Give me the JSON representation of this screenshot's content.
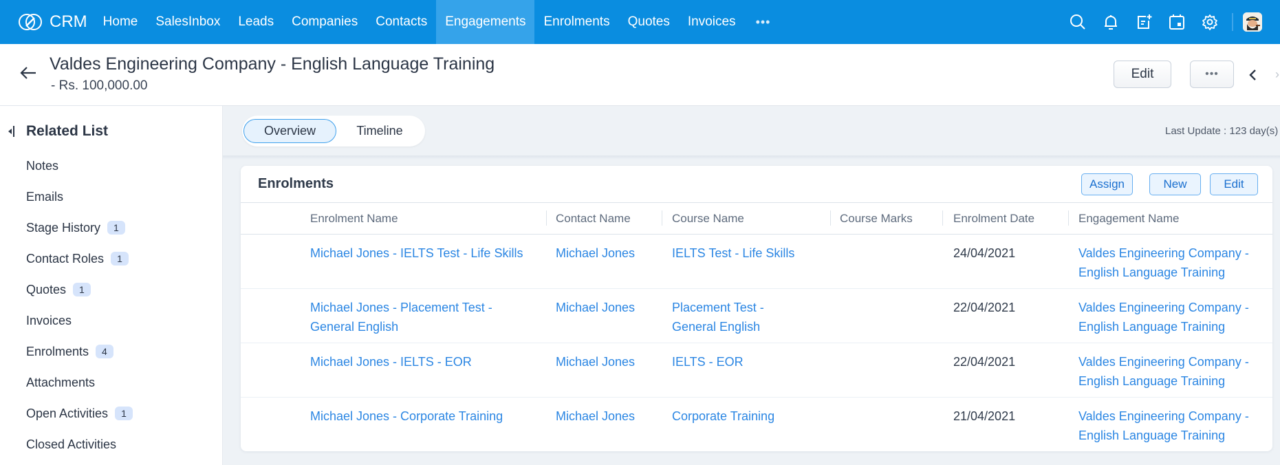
{
  "nav": {
    "brand": "CRM",
    "items": [
      {
        "label": "Home",
        "active": false
      },
      {
        "label": "SalesInbox",
        "active": false
      },
      {
        "label": "Leads",
        "active": false
      },
      {
        "label": "Companies",
        "active": false
      },
      {
        "label": "Contacts",
        "active": false
      },
      {
        "label": "Engagements",
        "active": true
      },
      {
        "label": "Enrolments",
        "active": false
      },
      {
        "label": "Quotes",
        "active": false
      },
      {
        "label": "Invoices",
        "active": false
      }
    ],
    "more": "•••",
    "icons": [
      "search-icon",
      "bell-icon",
      "new-note-icon",
      "calendar-icon",
      "gear-icon"
    ],
    "colors": {
      "bar": "#0a8de0",
      "active": "#35a3ea"
    }
  },
  "record": {
    "title": "Valdes Engineering Company - English Language Training",
    "subtitle": "-  Rs. 100,000.00",
    "edit_label": "Edit",
    "more_label": "•••",
    "next_partial": "›"
  },
  "sidebar": {
    "title": "Related List",
    "items": [
      {
        "label": "Notes",
        "count": null
      },
      {
        "label": "Emails",
        "count": null
      },
      {
        "label": "Stage History",
        "count": "1"
      },
      {
        "label": "Contact Roles",
        "count": "1"
      },
      {
        "label": "Quotes",
        "count": "1"
      },
      {
        "label": "Invoices",
        "count": null
      },
      {
        "label": "Enrolments",
        "count": "4"
      },
      {
        "label": "Attachments",
        "count": null
      },
      {
        "label": "Open Activities",
        "count": "1"
      },
      {
        "label": "Closed Activities",
        "count": null
      }
    ]
  },
  "tabs": [
    {
      "label": "Overview",
      "active": true
    },
    {
      "label": "Timeline",
      "active": false
    }
  ],
  "last_update": "Last Update : 123 day(s)",
  "enrolments": {
    "title": "Enrolments",
    "buttons": {
      "assign": "Assign",
      "new": "New",
      "edit": "Edit"
    },
    "columns": [
      "Enrolment Name",
      "Contact Name",
      "Course Name",
      "Course Marks",
      "Enrolment Date",
      "Engagement Name"
    ],
    "rows": [
      {
        "enrolment_name": "Michael Jones - IELTS Test - Life Skills",
        "contact_name": "Michael Jones",
        "course_name": "IELTS Test - Life Skills",
        "course_marks": "",
        "enrolment_date": "24/04/2021",
        "engagement_name": "Valdes Engineering Company - English Language Training"
      },
      {
        "enrolment_name": "Michael Jones - Placement Test - General English",
        "contact_name": "Michael Jones",
        "course_name": "Placement Test - General English",
        "course_marks": "",
        "enrolment_date": "22/04/2021",
        "engagement_name": "Valdes Engineering Company - English Language Training"
      },
      {
        "enrolment_name": "Michael Jones - IELTS - EOR",
        "contact_name": "Michael Jones",
        "course_name": "IELTS - EOR",
        "course_marks": "",
        "enrolment_date": "22/04/2021",
        "engagement_name": "Valdes Engineering Company - English Language Training"
      },
      {
        "enrolment_name": "Michael Jones - Corporate Training",
        "contact_name": "Michael Jones",
        "course_name": "Corporate Training",
        "course_marks": "",
        "enrolment_date": "21/04/2021",
        "engagement_name": "Valdes Engineering Company - English Language Training"
      }
    ]
  }
}
